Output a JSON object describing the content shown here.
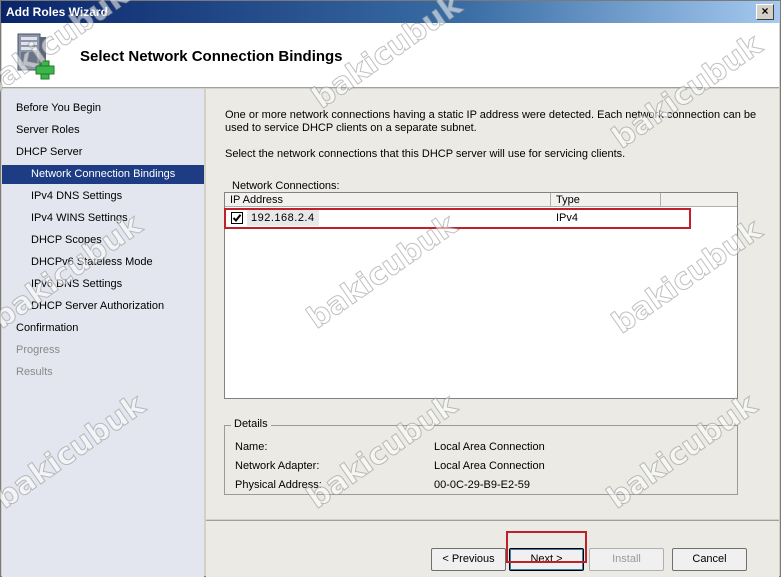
{
  "window": {
    "title": "Add Roles Wizard",
    "close_glyph": "×"
  },
  "header": {
    "title": "Select Network Connection Bindings",
    "icon": "server-add-icon"
  },
  "sidebar": {
    "items": [
      {
        "label": "Before You Begin",
        "state": "normal"
      },
      {
        "label": "Server Roles",
        "state": "normal"
      },
      {
        "label": "DHCP Server",
        "state": "normal"
      },
      {
        "label": "Network Connection Bindings",
        "state": "active"
      },
      {
        "label": "IPv4 DNS Settings",
        "state": "normal"
      },
      {
        "label": "IPv4 WINS Settings",
        "state": "normal"
      },
      {
        "label": "DHCP Scopes",
        "state": "normal"
      },
      {
        "label": "DHCPv6 Stateless Mode",
        "state": "normal"
      },
      {
        "label": "IPv6 DNS Settings",
        "state": "normal"
      },
      {
        "label": "DHCP Server Authorization",
        "state": "normal"
      },
      {
        "label": "Confirmation",
        "state": "normal"
      },
      {
        "label": "Progress",
        "state": "disabled"
      },
      {
        "label": "Results",
        "state": "disabled"
      }
    ]
  },
  "main": {
    "description1": "One or more network connections having a static IP address were detected. Each network connection can be used to service DHCP clients on a separate subnet.",
    "description2": "Select the network connections that this DHCP server will use for servicing clients.",
    "list_label": "Network Connections:",
    "columns": [
      "IP Address",
      "Type"
    ],
    "rows": [
      {
        "checked": true,
        "ip": "192.168.2.4",
        "type": "IPv4"
      }
    ],
    "details": {
      "legend": "Details",
      "name_label": "Name:",
      "name_value": "Local Area Connection",
      "adapter_label": "Network Adapter:",
      "adapter_value": "Local Area Connection",
      "address_label": "Physical Address:",
      "address_value": "00-0C-29-B9-E2-59"
    }
  },
  "footer": {
    "previous_label": "< Previous",
    "next_label": "Next >",
    "install_label": "Install",
    "cancel_label": "Cancel"
  },
  "watermark": "bakicubuk",
  "colors": {
    "active_nav": "#1d3c84",
    "highlight_box": "#c0202a",
    "title_bar": "#0a246a"
  }
}
